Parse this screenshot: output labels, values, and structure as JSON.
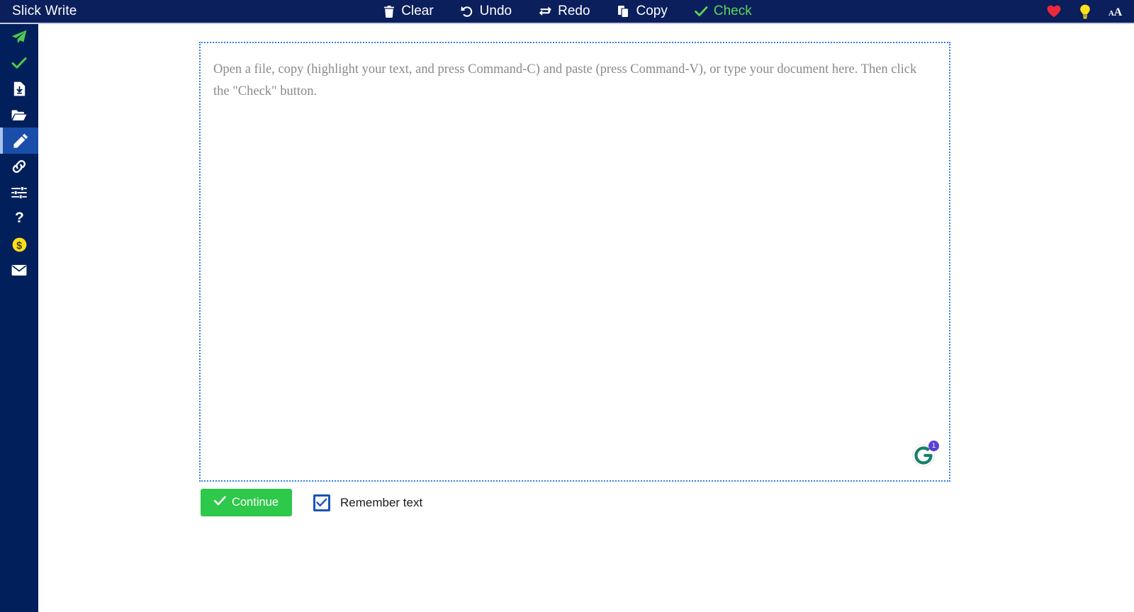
{
  "app": {
    "brand": "Slick Write",
    "header_bg": "#0a1f5c",
    "sidebar_bg": "#001f5b",
    "accent_green": "#5cd65c",
    "button_green": "#2ec84a",
    "active_item_bg": "#1a4eab"
  },
  "toolbar": {
    "items": [
      {
        "label": "Clear",
        "icon": "trash-icon",
        "color": "#ffffff"
      },
      {
        "label": "Undo",
        "icon": "undo-arrow-icon",
        "color": "#ffffff"
      },
      {
        "label": "Redo",
        "icon": "redo-arrows-icon",
        "color": "#ffffff"
      },
      {
        "label": "Copy",
        "icon": "copy-icon",
        "color": "#ffffff"
      },
      {
        "label": "Check",
        "icon": "check-icon",
        "color": "#5cd65c"
      }
    ],
    "right_icons": [
      {
        "name": "heart-icon",
        "color": "#f0283c"
      },
      {
        "name": "lightbulb-icon",
        "color": "#ffe01b"
      },
      {
        "name": "font-size-icon",
        "color": "#ffffff"
      }
    ]
  },
  "sidebar": {
    "items": [
      {
        "name": "sidebar-item-send",
        "icon": "paper-plane-icon",
        "color": "#4ec94e",
        "active": false
      },
      {
        "name": "sidebar-item-check",
        "icon": "check-icon",
        "color": "#4ec94e",
        "active": false
      },
      {
        "name": "sidebar-item-save",
        "icon": "file-download-icon",
        "color": "#ffffff",
        "active": false
      },
      {
        "name": "sidebar-item-open",
        "icon": "folder-open-icon",
        "color": "#ffffff",
        "active": false
      },
      {
        "name": "sidebar-item-edit",
        "icon": "pencil-icon",
        "color": "#ffffff",
        "active": true
      },
      {
        "name": "sidebar-item-link",
        "icon": "chain-link-icon",
        "color": "#ffffff",
        "active": false
      },
      {
        "name": "sidebar-item-settings",
        "icon": "sliders-icon",
        "color": "#ffffff",
        "active": false
      },
      {
        "name": "sidebar-item-help",
        "icon": "question-mark-icon",
        "color": "#ffffff",
        "active": false
      },
      {
        "name": "sidebar-item-donate",
        "icon": "dollar-coin-icon",
        "color": "#ffe01b",
        "active": false
      },
      {
        "name": "sidebar-item-contact",
        "icon": "envelope-icon",
        "color": "#ffffff",
        "active": false
      }
    ]
  },
  "editor": {
    "value": "",
    "placeholder": "Open a file, copy (highlight your text, and press Command-C) and paste (press Command-V), or type your document here. Then click the \"Check\" button.",
    "border_color": "#2f7fe0"
  },
  "grammarly": {
    "name": "grammarly-widget",
    "badge_count": "1",
    "logo_color": "#15806b",
    "badge_color": "#5b3fd4"
  },
  "controls": {
    "continue_label": "Continue",
    "remember_label": "Remember text",
    "remember_checked": true
  }
}
